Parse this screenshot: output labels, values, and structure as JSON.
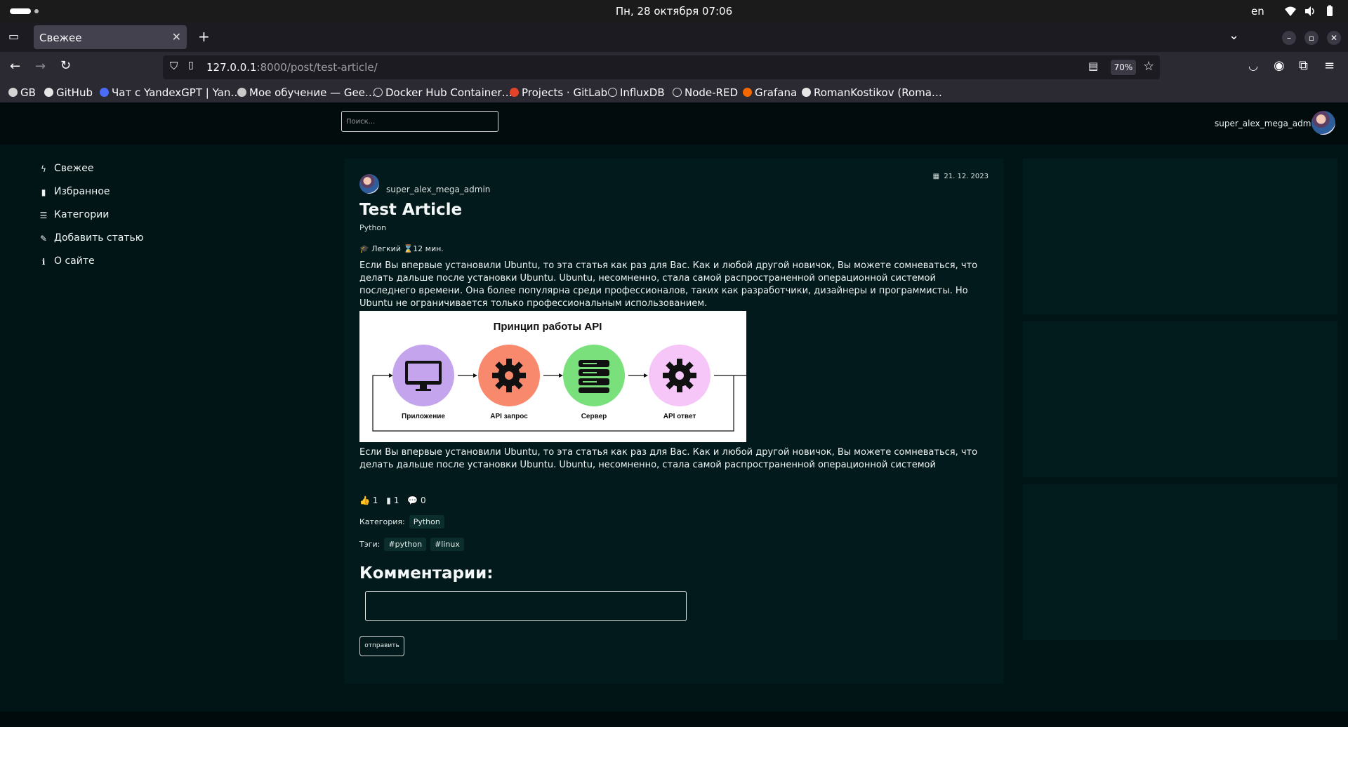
{
  "system": {
    "clock": "Пн, 28 октября  07:06",
    "lang": "en"
  },
  "browser": {
    "tab_title": "Свежее",
    "url_host": "127.0.0.1",
    "url_rest": ":8000/post/test-article/",
    "zoom": "70%",
    "bookmarks": [
      "GB",
      "GitHub",
      "Чат с YandexGPT | Yan…",
      "Мое обучение — Gee…",
      "Docker Hub Container…",
      "Projects · GitLab",
      "InfluxDB",
      "Node-RED",
      "Grafana",
      "RomanKostikov (Roma…"
    ]
  },
  "site": {
    "search_placeholder": "Поиск...",
    "user": "super_alex_mega_admin",
    "sidebar": [
      {
        "icon": "bolt-icon",
        "label": "Свежее"
      },
      {
        "icon": "bookmark-icon",
        "label": "Избранное"
      },
      {
        "icon": "list-icon",
        "label": "Категории"
      },
      {
        "icon": "pencil-icon",
        "label": "Добавить статью"
      },
      {
        "icon": "info-icon",
        "label": "О сайте"
      }
    ],
    "article": {
      "author": "super_alex_mega_admin",
      "date": "21. 12. 2023",
      "title": "Test Article",
      "category_line": "Python",
      "difficulty": "Легкий",
      "read_time": "12 мин.",
      "paragraph1": "Если Вы впервые установили Ubuntu, то эта статья как раз для Вас. Как и любой другой новичок, Вы можете сомневаться, что делать дальше после установки Ubuntu. Ubuntu, несомненно, стала самой распространенной операционной системой последнего времени. Она более популярна среди профессионалов, таких как разработчики, дизайнеры и программисты. Но Ubuntu не ограничивается только профессиональным использованием.",
      "image": {
        "title": "Принцип работы API",
        "steps": [
          {
            "label": "Приложение",
            "color": "#c4a4ec",
            "icon": "monitor-icon"
          },
          {
            "label": "API запрос",
            "color": "#f9896c",
            "icon": "gear-icon"
          },
          {
            "label": "Сервер",
            "color": "#79e07c",
            "icon": "server-icon"
          },
          {
            "label": "API ответ",
            "color": "#f6c6f8",
            "icon": "gear-icon"
          }
        ]
      },
      "paragraph2": "Если Вы впервые установили Ubuntu, то эта статья как раз для Вас. Как и любой другой новичок, Вы можете сомневаться, что делать дальше после установки Ubuntu. Ubuntu, несомненно, стала самой распространенной операционной системой",
      "likes": "1",
      "bookmarks": "1",
      "comments_count": "0",
      "category_label": "Категория:",
      "category": "Python",
      "tags_label": "Тэги:",
      "tags": [
        "#python",
        "#linux"
      ],
      "comments_title": "Комментарии:",
      "send_label": "отправить"
    }
  }
}
